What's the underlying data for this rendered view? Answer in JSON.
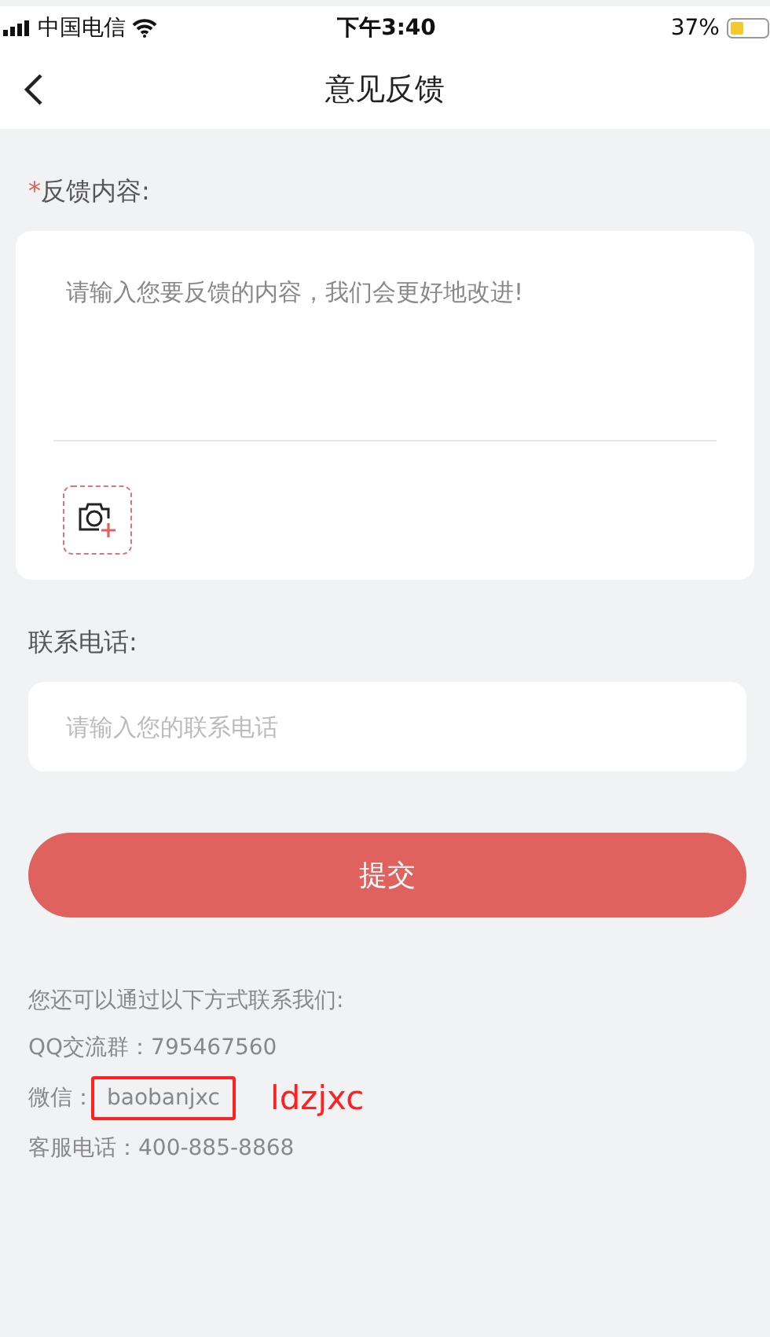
{
  "status_bar": {
    "carrier": "中国电信",
    "time": "下午3:40",
    "battery": "37%"
  },
  "nav": {
    "title": "意见反馈"
  },
  "feedback": {
    "required_mark": "*",
    "label": "反馈内容:",
    "placeholder": "请输入您要反馈的内容，我们会更好地改进!"
  },
  "phone": {
    "label": "联系电话:",
    "placeholder": "请输入您的联系电话"
  },
  "submit": "提交",
  "contact": {
    "intro": "您还可以通过以下方式联系我们:",
    "lines": [
      {
        "label": "QQ交流群：",
        "value": "795467560",
        "highlighted": false
      },
      {
        "label": "微信：",
        "value": "baobanjxc",
        "highlighted": true,
        "note": "ldzjxc"
      },
      {
        "label": "客服电话：",
        "value": "400-885-8868",
        "highlighted": false
      }
    ]
  }
}
